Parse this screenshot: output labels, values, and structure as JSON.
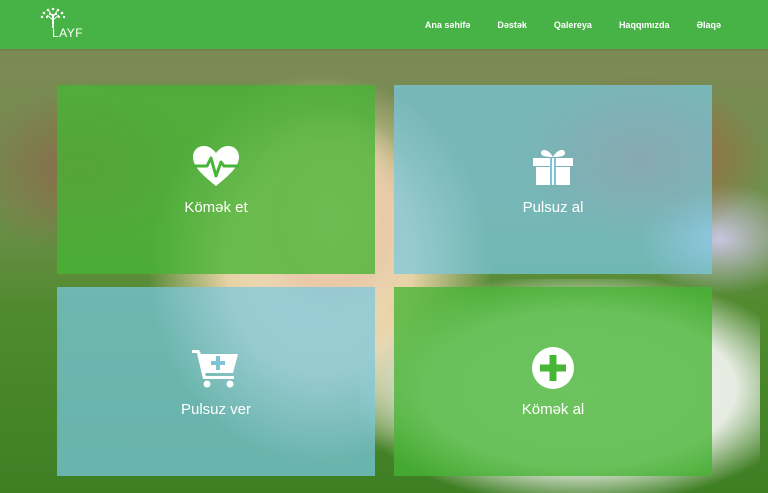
{
  "brand": {
    "name": "LAYF"
  },
  "nav": {
    "items": [
      "Ana səhifə",
      "Dəstək",
      "Qalereya",
      "Haqqımızda",
      "Əlaqə"
    ]
  },
  "tiles": [
    {
      "label": "Kömək et",
      "icon": "heart-pulse-icon",
      "color": "#47b535"
    },
    {
      "label": "Pulsuz al",
      "icon": "gift-icon",
      "color": "#78c8e1"
    },
    {
      "label": "Pulsuz ver",
      "icon": "cart-plus-icon",
      "color": "#78c8e1"
    },
    {
      "label": "Kömək al",
      "icon": "plus-circle-icon",
      "color": "#47b535"
    }
  ],
  "colors": {
    "header": "#47b347"
  }
}
